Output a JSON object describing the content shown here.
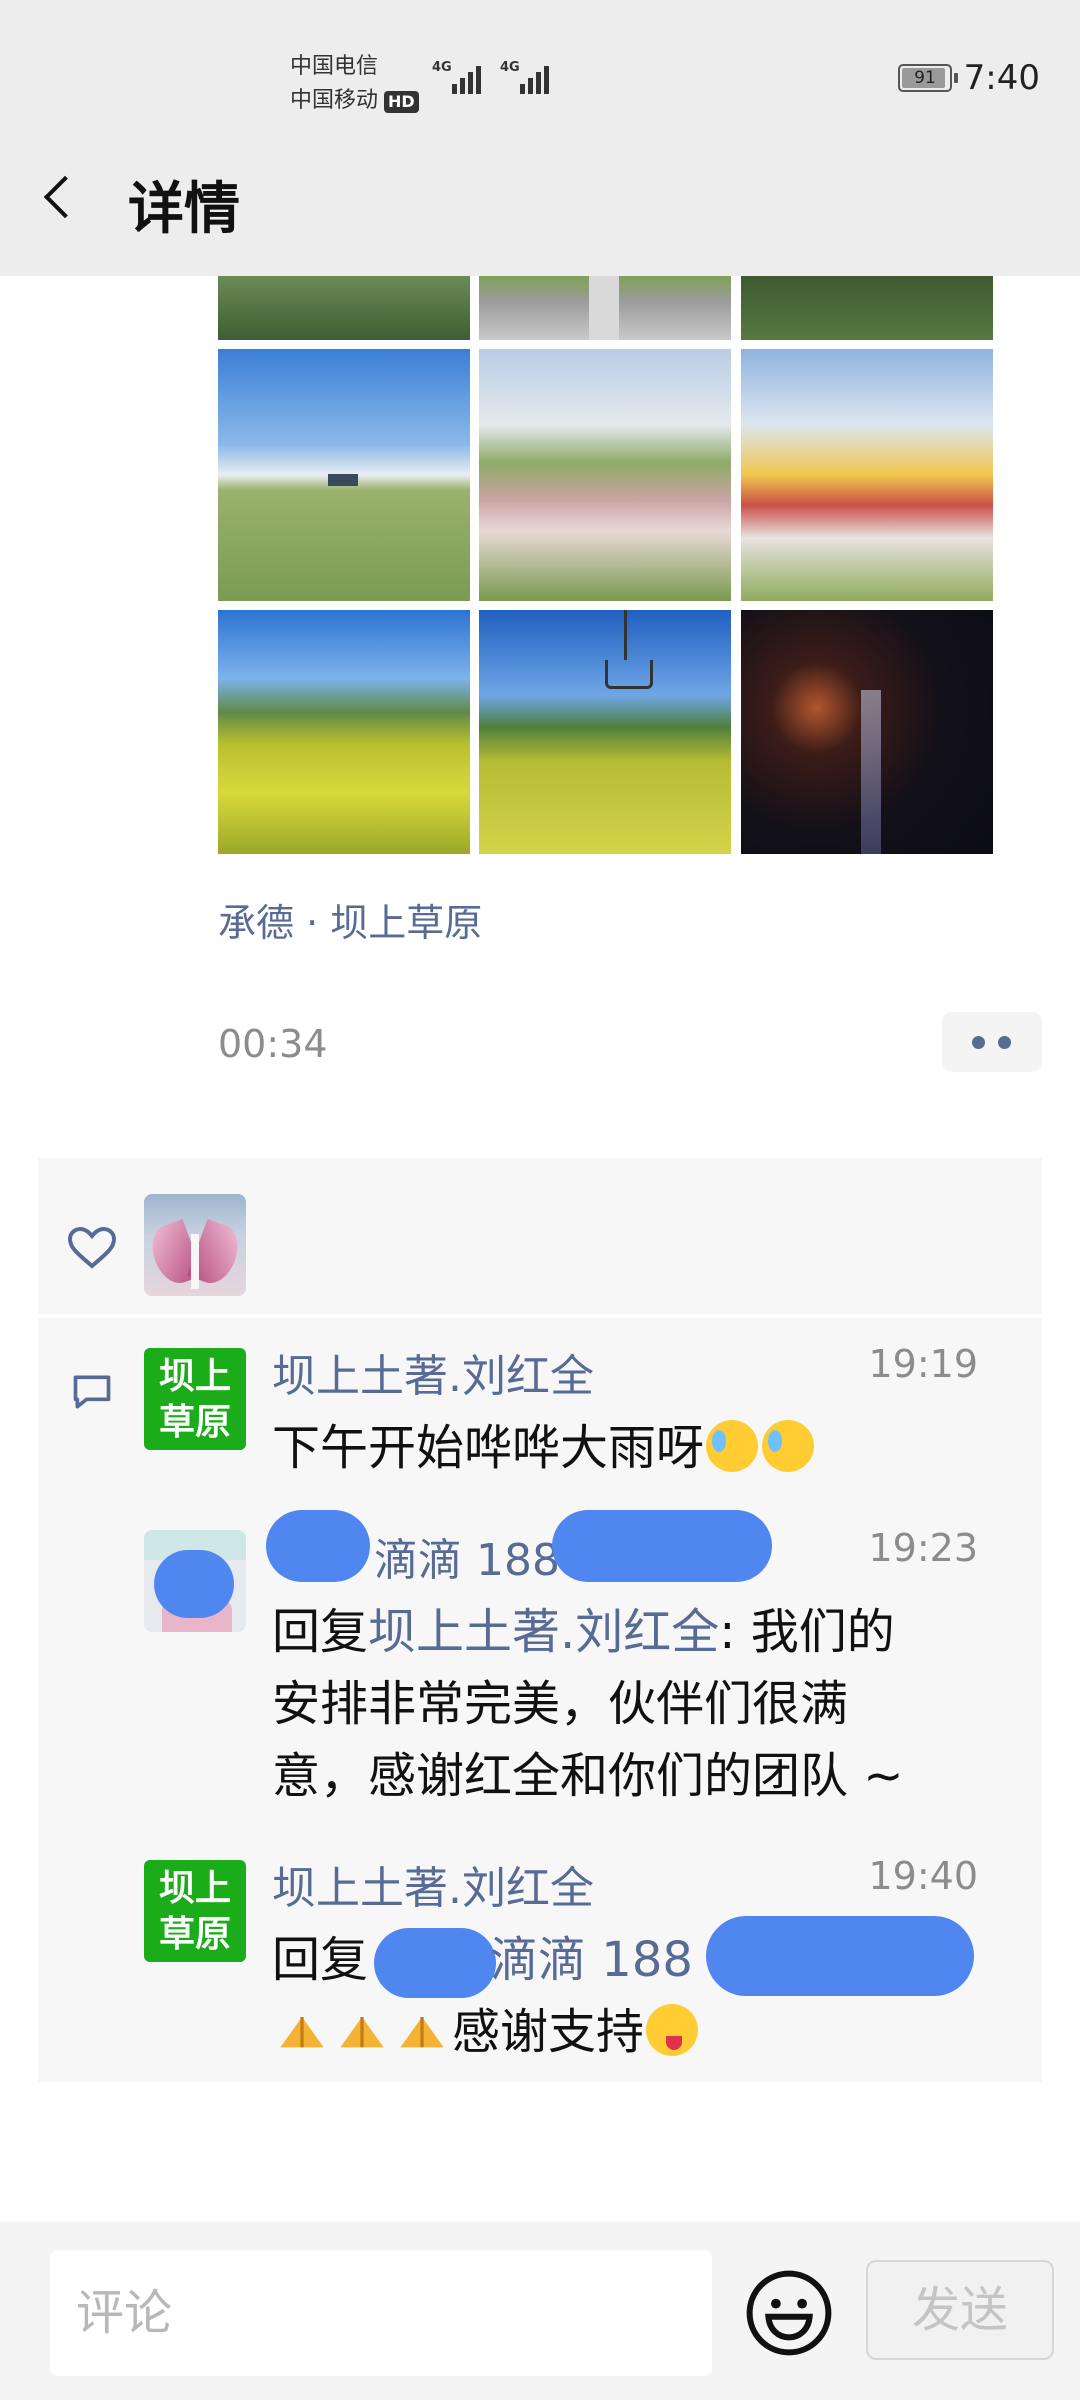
{
  "status_bar": {
    "carrier_1": "中国电信",
    "carrier_2": "中国移动",
    "hd_badge": "HD",
    "signal_1": "4G",
    "signal_2": "4G",
    "battery": "91",
    "time": "7:40"
  },
  "header": {
    "title": "详情"
  },
  "post": {
    "location": "承德 · 坝上草原",
    "time": "00:34",
    "photos": [
      "grass",
      "road",
      "grass-dark",
      "hikers",
      "group-photo-1",
      "group-photo-2",
      "rapeseed",
      "chairlift",
      "fireworks"
    ]
  },
  "likes": {
    "icon": "heart-icon"
  },
  "comments": [
    {
      "avatar_text": "坝上草原",
      "name": "坝上土著.刘红全",
      "time": "19:19",
      "text": "下午开始哗哗大雨呀"
    },
    {
      "avatar_text": "",
      "name": "滴滴 188",
      "time": "19:23",
      "reply_prefix": "回复",
      "reply_to": "坝上土著.刘红全",
      "line1_rest": ": 我们的",
      "line2": "安排非常完美，伙伴们很满",
      "line3": "意，感谢红全和你们的团队 ~"
    },
    {
      "avatar_text": "坝上草原",
      "name": "坝上土著.刘红全",
      "time": "19:40",
      "reply_prefix": "回复",
      "reply_to": "滴滴 188",
      "text": "感谢支持"
    }
  ],
  "input": {
    "placeholder": "评论",
    "send_label": "发送"
  },
  "colors": {
    "link": "#576b95",
    "green": "#1aad19",
    "redact": "#4f86f0"
  }
}
